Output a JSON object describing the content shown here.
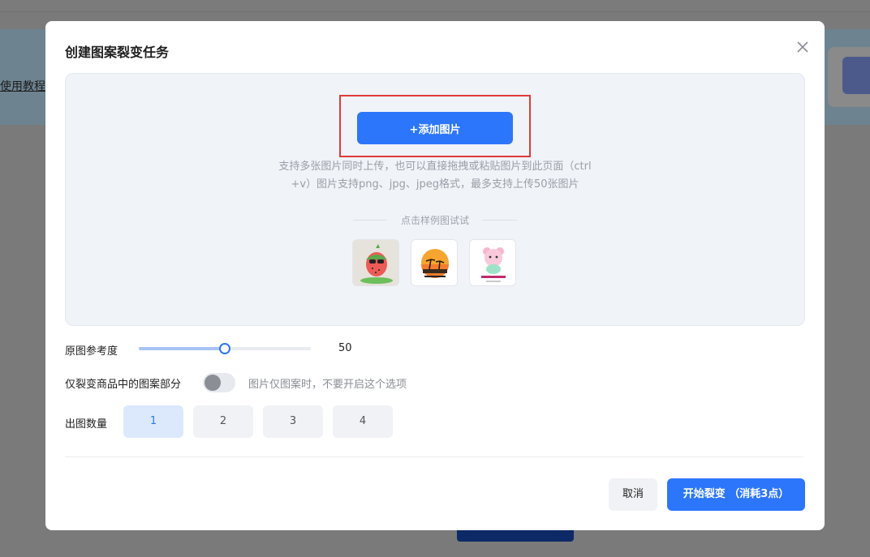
{
  "background": {
    "tutorial_link": "使用教程"
  },
  "modal": {
    "title": "创建图案裂变任务",
    "close_icon": "close-icon",
    "upload": {
      "button_label": "+添加图片",
      "hint_line1": "支持多张图片同时上传，也可以直接拖拽或粘贴图片到此页面（ctrl",
      "hint_line2": "+v）图片支持png、jpg、jpeg格式，最多支持上传50张图片",
      "sample_label": "点击样例图试试",
      "samples": [
        "watermelon-character-image",
        "sunset-palm-badge-image",
        "pink-bear-sticker-image"
      ]
    },
    "reference": {
      "label": "原图参考度",
      "value": 50,
      "min": 0,
      "max": 100,
      "value_text": "50"
    },
    "pattern_only": {
      "label": "仅裂变商品中的图案部分",
      "enabled": false,
      "hint": "图片仅图案时，不要开启这个选项"
    },
    "output_count": {
      "label": "出图数量",
      "options": [
        "1",
        "2",
        "3",
        "4"
      ],
      "selected": "1"
    },
    "footer": {
      "cancel_label": "取消",
      "start_label": "开始裂变 （消耗3点）"
    }
  },
  "colors": {
    "accent": "#2c76fb",
    "highlight_outline": "#e03a3a"
  }
}
